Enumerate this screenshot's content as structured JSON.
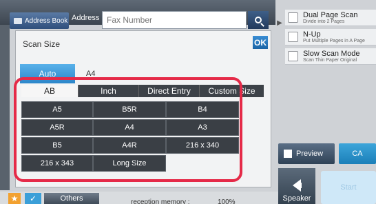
{
  "header": {
    "address_book_label": "Address Book",
    "address_label": "Address",
    "fax_placeholder": "Fax Number"
  },
  "dialog": {
    "title": "Scan Size",
    "ok_label": "OK",
    "auto_label": "Auto",
    "auto_value": "A4",
    "tabs": [
      {
        "label": "AB",
        "active": true
      },
      {
        "label": "Inch",
        "active": false
      },
      {
        "label": "Direct Entry",
        "active": false
      },
      {
        "label": "Custom Size",
        "active": false
      }
    ],
    "sizes": [
      "A5",
      "B5R",
      "B4",
      "A5R",
      "A4",
      "A3",
      "B5",
      "A4R",
      "216 x 340",
      "216 x 343",
      "Long Size"
    ]
  },
  "options": [
    {
      "title": "Dual Page Scan",
      "subtitle": "Divide into 2 Pages"
    },
    {
      "title": "N-Up",
      "subtitle": "Put Multiple Pages in A Page"
    },
    {
      "title": "Slow Scan Mode",
      "subtitle": "Scan Thin Paper Original"
    }
  ],
  "actions": {
    "preview_label": "Preview",
    "ca_label": "CA",
    "speaker_label": "Speaker",
    "start_label": "Start"
  },
  "footer": {
    "others_label": "Others",
    "memory_label": "reception memory :",
    "memory_value": "100%"
  },
  "colors": {
    "highlight": "#e52a48",
    "accent_blue": "#2c86c9",
    "star_orange": "#f2a130"
  }
}
